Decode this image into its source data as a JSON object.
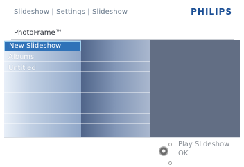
{
  "header": {
    "breadcrumb": "Slideshow | Settings | Slideshow",
    "brand": "PHILIPS"
  },
  "device": {
    "label": "PhotoFrame™"
  },
  "menu": {
    "items": [
      {
        "label": "New Slideshow",
        "selected": true
      },
      {
        "label": "Albums",
        "selected": false
      },
      {
        "label": "Untitled",
        "selected": false
      }
    ]
  },
  "footer": {
    "up_hint": "Play Slideshow",
    "ok_hint": "OK"
  },
  "colors": {
    "brand": "#1b4f95",
    "selection": "#2f72b8",
    "accent_rule": "#6fb5c9",
    "right_panel": "#626e84"
  }
}
